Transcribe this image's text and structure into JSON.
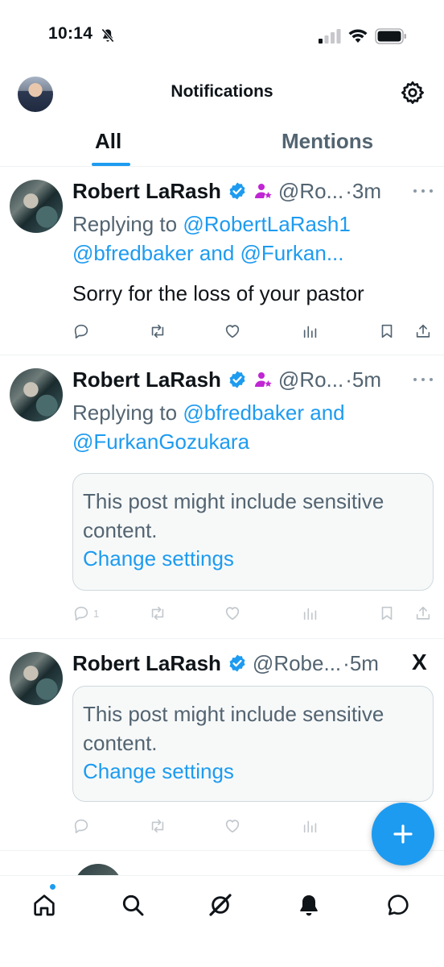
{
  "status_bar": {
    "time": "10:14"
  },
  "header": {
    "title": "Notifications"
  },
  "tabs": [
    {
      "label": "All",
      "active": true
    },
    {
      "label": "Mentions",
      "active": false
    }
  ],
  "posts": [
    {
      "author_name": "Robert LaRash",
      "handle": "@Ro...",
      "time": "·3m",
      "reply_prefix": "Replying to ",
      "reply_line1_link": "@RobertLaRash1",
      "reply_line2_link": "@bfredbaker and @Furkan...",
      "text": "Sorry for the loss of your pastor"
    },
    {
      "author_name": "Robert LaRash",
      "handle": "@Ro...",
      "time": "·5m",
      "reply_prefix": "Replying to ",
      "reply_line1_link": "@bfredbaker and",
      "reply_line2_link": "@FurkanGozukara",
      "sensitive_text": "This post might include sensitive content.",
      "sensitive_link": "Change settings",
      "reply_count": "1"
    },
    {
      "author_name": "Robert LaRash",
      "handle": "@Robe...",
      "time": "·5m",
      "x_label": "X",
      "sensitive_text": "This post might include sensitive content.",
      "sensitive_link": "Change settings"
    }
  ],
  "icons": {
    "verified": "verified-badge-icon",
    "affiliate": "affiliate-badge-icon",
    "reply": "reply-icon",
    "repost": "repost-icon",
    "like": "like-icon",
    "views": "views-icon",
    "bookmark": "bookmark-icon",
    "share": "share-icon"
  },
  "colors": {
    "accent": "#1d9bf0",
    "text": "#0f1419",
    "secondary": "#536471",
    "affiliate": "#c026d3"
  },
  "bottom_nav": [
    "home",
    "search",
    "grok",
    "notifications",
    "messages"
  ]
}
